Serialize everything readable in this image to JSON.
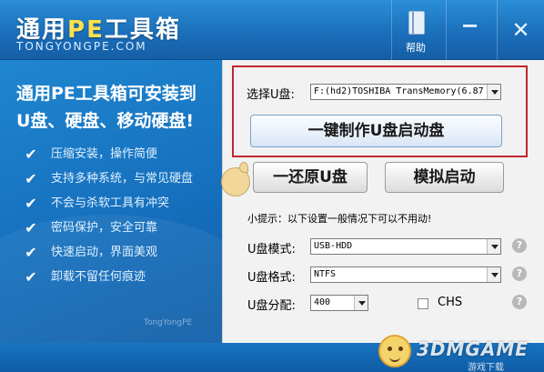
{
  "app": {
    "title_prefix": "通用",
    "title_pe": "PE",
    "title_suffix": "工具箱",
    "subtitle": "TONGYONGPE.COM"
  },
  "titlebar": {
    "help_label": "帮助",
    "minimize_glyph": "−",
    "close_glyph": "✕"
  },
  "left_panel": {
    "headline_line1": "通用PE工具箱可安装到",
    "headline_line2": "U盘、硬盘、移动硬盘!",
    "features": [
      {
        "label": "压缩安装，操作简便",
        "icon": "check-icon"
      },
      {
        "label": "支持多种系统，与常见硬盘",
        "icon": "check-icon"
      },
      {
        "label": "不会与杀软工具有冲突",
        "icon": "check-icon"
      },
      {
        "label": "密码保护，安全可靠",
        "icon": "check-icon"
      },
      {
        "label": "快速启动，界面美观",
        "icon": "check-icon"
      },
      {
        "label": "卸载不留任何痕迹",
        "icon": "check-icon"
      }
    ],
    "brand_small": "TongYongPE"
  },
  "right_panel": {
    "select_disk_label": "选择U盘:",
    "select_disk_value": "F:(hd2)TOSHIBA TransMemory(6.87",
    "make_button": "一键制作U盘启动盘",
    "restore_button": "一还原U盘",
    "simulate_button": "模拟启动",
    "tip": "小提示：以下设置一般情况下可以不用动!",
    "mode_label": "U盘模式:",
    "mode_value": "USB-HDD",
    "format_label": "U盘格式:",
    "format_value": "NTFS",
    "partition_label": "U盘分配:",
    "partition_value": "400",
    "chs_label": "CHS",
    "help_glyph": "?"
  },
  "watermark": {
    "brand": "3DMGAME",
    "sub": "游戏下载"
  },
  "colors": {
    "titlebar": "#1b6fbb",
    "left_panel": "#1670bd",
    "highlight_box": "#c1272d",
    "logo_accent": "#ffe14a"
  }
}
